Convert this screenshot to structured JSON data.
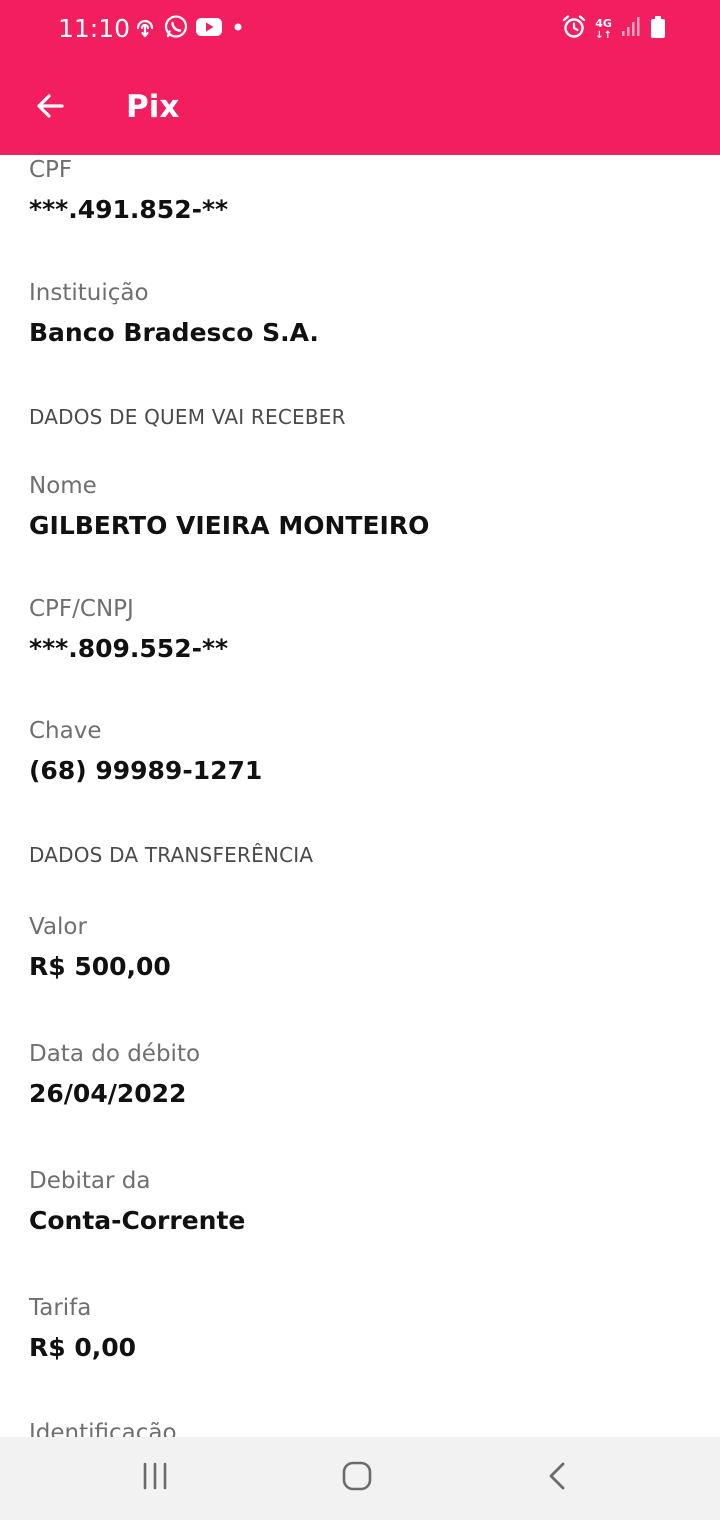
{
  "status_bar": {
    "time": "11:10",
    "network": "4G",
    "icons": [
      "airdrop-icon",
      "whatsapp-icon",
      "youtube-icon",
      "dot-icon",
      "alarm-icon",
      "signal-icon",
      "battery-icon"
    ]
  },
  "header": {
    "title": "Pix",
    "back_icon": "arrow-left-icon",
    "background_color": "#f21e60"
  },
  "payer": {
    "cpf_label": "CPF",
    "cpf_value": "***.491.852-**",
    "institution_label": "Instituição",
    "institution_value": "Banco Bradesco S.A."
  },
  "receiver": {
    "section_title": "DADOS DE QUEM VAI RECEBER",
    "name_label": "Nome",
    "name_value": "GILBERTO VIEIRA MONTEIRO",
    "doc_label": "CPF/CNPJ",
    "doc_value": "***.809.552-**",
    "key_label": "Chave",
    "key_value": "(68) 99989-1271"
  },
  "transfer": {
    "section_title": "DADOS DA TRANSFERÊNCIA",
    "amount_label": "Valor",
    "amount_value": "R$ 500,00",
    "date_label": "Data do débito",
    "date_value": "26/04/2022",
    "account_label": "Debitar da",
    "account_value": "Conta-Corrente",
    "fee_label": "Tarifa",
    "fee_value": "R$ 0,00",
    "identification_label": "Identificação"
  },
  "nav_bar": {
    "icons": [
      "recent-apps-icon",
      "home-icon",
      "back-icon"
    ]
  }
}
